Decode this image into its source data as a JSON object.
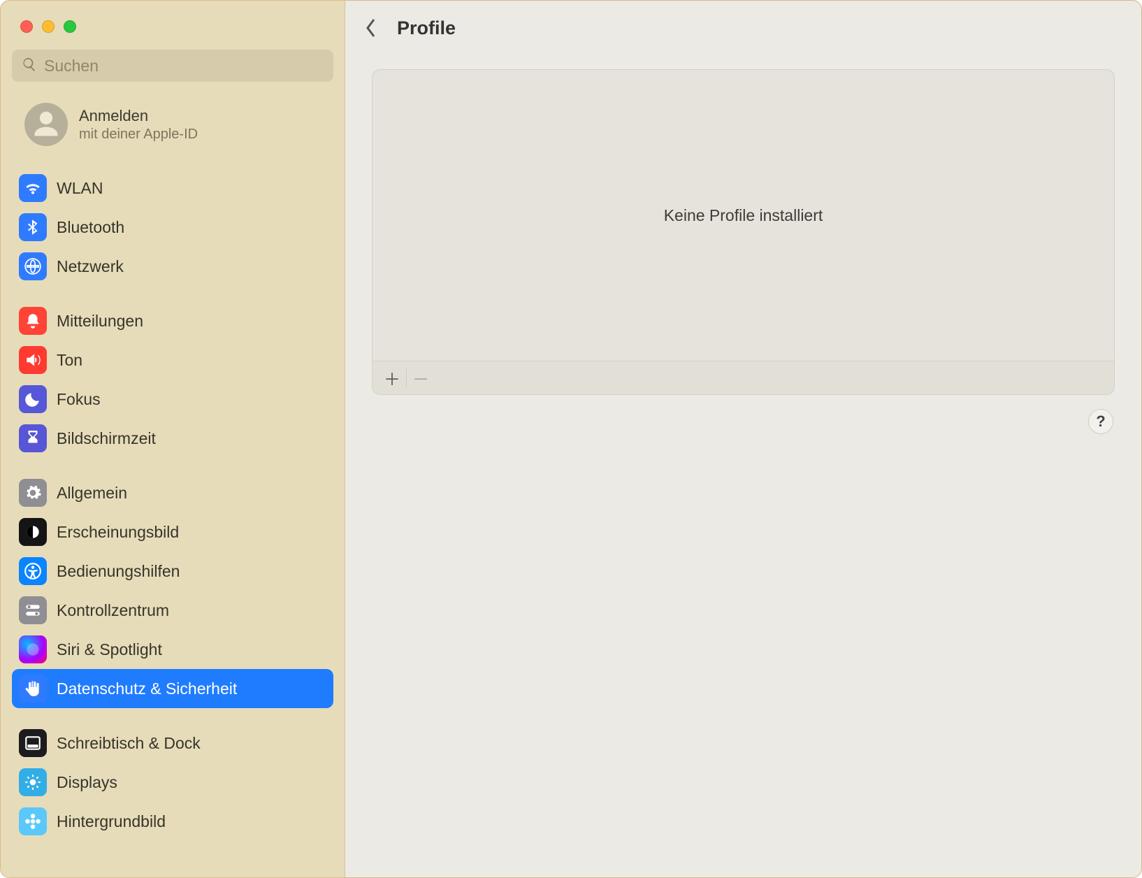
{
  "search": {
    "placeholder": "Suchen"
  },
  "account": {
    "title": "Anmelden",
    "subtitle": "mit deiner Apple-ID"
  },
  "sidebar": {
    "groups": [
      {
        "items": [
          {
            "label": "WLAN",
            "icon": "wifi",
            "bg": "bg-blue"
          },
          {
            "label": "Bluetooth",
            "icon": "bluetooth",
            "bg": "bg-blue"
          },
          {
            "label": "Netzwerk",
            "icon": "globe",
            "bg": "bg-blue"
          }
        ]
      },
      {
        "items": [
          {
            "label": "Mitteilungen",
            "icon": "bell",
            "bg": "bg-red"
          },
          {
            "label": "Ton",
            "icon": "speaker",
            "bg": "bg-red2"
          },
          {
            "label": "Fokus",
            "icon": "moon",
            "bg": "bg-indigo"
          },
          {
            "label": "Bildschirmzeit",
            "icon": "hourglass",
            "bg": "bg-violet"
          }
        ]
      },
      {
        "items": [
          {
            "label": "Allgemein",
            "icon": "gear",
            "bg": "bg-gray"
          },
          {
            "label": "Erscheinungsbild",
            "icon": "appearance",
            "bg": "bg-black"
          },
          {
            "label": "Bedienungshilfen",
            "icon": "accessibility",
            "bg": "bg-bluea"
          },
          {
            "label": "Kontrollzentrum",
            "icon": "switches",
            "bg": "bg-grayl"
          },
          {
            "label": "Siri & Spotlight",
            "icon": "siri",
            "bg": "bg-siri"
          },
          {
            "label": "Datenschutz & Sicherheit",
            "icon": "hand",
            "bg": "bg-bluep",
            "selected": true
          }
        ]
      },
      {
        "items": [
          {
            "label": "Schreibtisch & Dock",
            "icon": "dock",
            "bg": "bg-black2"
          },
          {
            "label": "Displays",
            "icon": "sun",
            "bg": "bg-cyan"
          },
          {
            "label": "Hintergrundbild",
            "icon": "flower",
            "bg": "bg-teal"
          }
        ]
      }
    ]
  },
  "main": {
    "title": "Profile",
    "emptyMessage": "Keine Profile installiert",
    "helpGlyph": "?"
  }
}
